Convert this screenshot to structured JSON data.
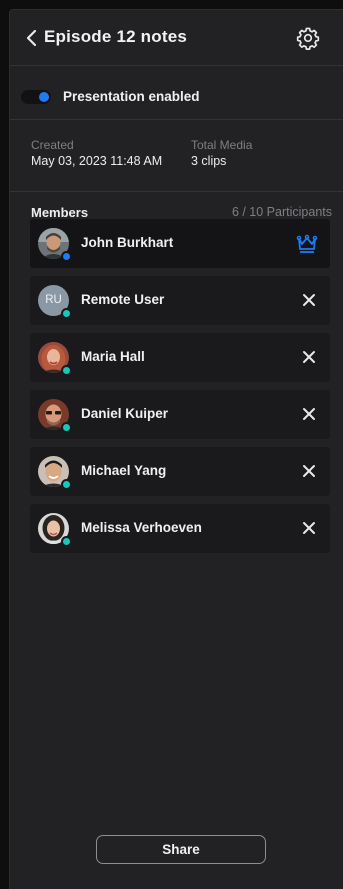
{
  "header": {
    "title": "Episode 12 notes"
  },
  "presentation": {
    "label": "Presentation enabled",
    "enabled": true
  },
  "meta": {
    "created_label": "Created",
    "created_value": "May 03, 2023 11:48 AM",
    "media_label": "Total Media",
    "media_value": "3 clips"
  },
  "members": {
    "title": "Members",
    "count": "6 / 10 Participants",
    "list": [
      {
        "name": "John Burkhart",
        "role": "owner",
        "status": "#1e7bf2"
      },
      {
        "name": "Remote User",
        "initials": "RU",
        "status": "#19c7b8"
      },
      {
        "name": "Maria Hall",
        "status": "#19c7b8"
      },
      {
        "name": "Daniel Kuiper",
        "status": "#19c7b8"
      },
      {
        "name": "Michael Yang",
        "status": "#19c7b8"
      },
      {
        "name": "Melissa Verhoeven",
        "status": "#19c7b8"
      }
    ]
  },
  "footer": {
    "share_label": "Share"
  },
  "colors": {
    "accent": "#1e7bf2",
    "online": "#19c7b8"
  }
}
